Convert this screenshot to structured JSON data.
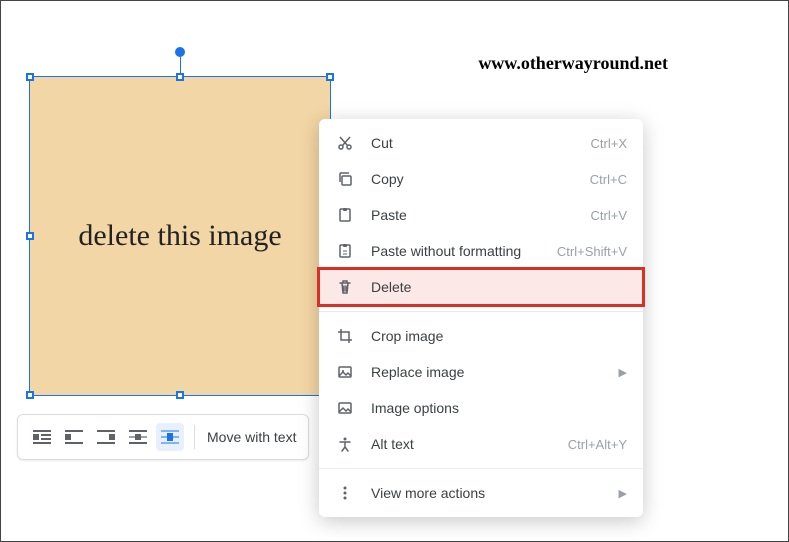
{
  "watermark": "www.otherwayround.net",
  "image": {
    "caption": "delete this image"
  },
  "toolbar": {
    "buttons": [
      "wrap-inline",
      "wrap-break-left",
      "wrap-break-right",
      "wrap-behind",
      "wrap-front"
    ],
    "move_label": "Move with text"
  },
  "menu": {
    "cut": {
      "label": "Cut",
      "shortcut": "Ctrl+X"
    },
    "copy": {
      "label": "Copy",
      "shortcut": "Ctrl+C"
    },
    "paste": {
      "label": "Paste",
      "shortcut": "Ctrl+V"
    },
    "paste_plain": {
      "label": "Paste without formatting",
      "shortcut": "Ctrl+Shift+V"
    },
    "delete": {
      "label": "Delete",
      "shortcut": ""
    },
    "crop": {
      "label": "Crop image",
      "shortcut": ""
    },
    "replace": {
      "label": "Replace image",
      "shortcut": ""
    },
    "options": {
      "label": "Image options",
      "shortcut": ""
    },
    "alt": {
      "label": "Alt text",
      "shortcut": "Ctrl+Alt+Y"
    },
    "more": {
      "label": "View more actions",
      "shortcut": ""
    }
  }
}
